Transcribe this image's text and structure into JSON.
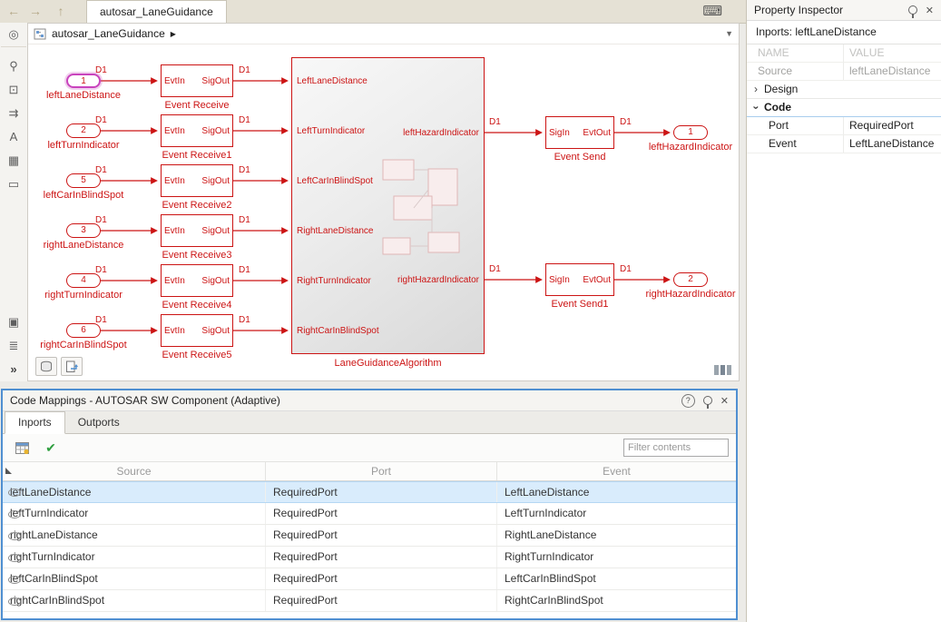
{
  "colors": {
    "diagram_red": "#cc1414",
    "selection_magenta": "#c943bd",
    "panel_border_blue": "#4f8fd1",
    "selected_row_blue": "#d9ecfc",
    "check_green": "#2e9e3e"
  },
  "topbar": {
    "tab_title": "autosar_LaneGuidance",
    "icons": {
      "back": "←",
      "forward": "→",
      "up": "↑",
      "keyboard": "⌨"
    }
  },
  "canvas": {
    "breadcrumb": "autosar_LaneGuidance",
    "crumb_arrow": "▶",
    "dropdown_caret": "▼"
  },
  "palette": {
    "icons": [
      {
        "name": "previous-view-icon",
        "glyph": "◎"
      },
      {
        "name": "zoom-icon",
        "glyph": "⚲"
      },
      {
        "name": "fit-to-view-icon",
        "glyph": "⊡"
      },
      {
        "name": "signal-routing-icon",
        "glyph": "⇉"
      },
      {
        "name": "annotation-icon",
        "glyph": "A"
      },
      {
        "name": "image-icon",
        "glyph": "▦"
      },
      {
        "name": "area-select-icon",
        "glyph": "▭"
      },
      {
        "name": "camera-icon",
        "glyph": "▣"
      },
      {
        "name": "model-layers-icon",
        "glyph": "≣"
      },
      {
        "name": "expand-toolstrip-icon",
        "glyph": "»"
      }
    ]
  },
  "diagram": {
    "signal_label": "D1",
    "receive_in": "EvtIn",
    "receive_out": "SigOut",
    "send_in": "SigIn",
    "send_out": "EvtOut",
    "inports": [
      {
        "num": "1",
        "label": "leftLaneDistance",
        "selected": true
      },
      {
        "num": "2",
        "label": "leftTurnIndicator",
        "selected": false
      },
      {
        "num": "5",
        "label": "leftCarInBlindSpot",
        "selected": false
      },
      {
        "num": "3",
        "label": "rightLaneDistance",
        "selected": false
      },
      {
        "num": "4",
        "label": "rightTurnIndicator",
        "selected": false
      },
      {
        "num": "6",
        "label": "rightCarInBlindSpot",
        "selected": false
      }
    ],
    "receive_blocks": [
      "Event Receive",
      "Event Receive1",
      "Event Receive2",
      "Event Receive3",
      "Event Receive4",
      "Event Receive5"
    ],
    "algorithm": {
      "label": "LaneGuidanceAlgorithm",
      "inputs": [
        "LeftLaneDistance",
        "LeftTurnIndicator",
        "LeftCarInBlindSpot",
        "RightLaneDistance",
        "RightTurnIndicator",
        "RightCarInBlindSpot"
      ],
      "outputs": [
        "leftHazardIndicator",
        "rightHazardIndicator"
      ]
    },
    "send_blocks": [
      "Event Send",
      "Event Send1"
    ],
    "outports": [
      {
        "num": "1",
        "label": "leftHazardIndicator"
      },
      {
        "num": "2",
        "label": "rightHazardIndicator"
      }
    ]
  },
  "code_mappings": {
    "title": "Code Mappings - AUTOSAR SW Component (Adaptive)",
    "tabs": [
      "Inports",
      "Outports"
    ],
    "active_tab": "Inports",
    "filter_placeholder": "Filter contents",
    "check_glyph": "✔",
    "help_glyph": "?",
    "close_glyph": "✕",
    "columns": [
      "Source",
      "Port",
      "Event"
    ],
    "rows": [
      {
        "source": "leftLaneDistance",
        "port": "RequiredPort",
        "event": "LeftLaneDistance",
        "selected": true
      },
      {
        "source": "leftTurnIndicator",
        "port": "RequiredPort",
        "event": "LeftTurnIndicator",
        "selected": false
      },
      {
        "source": "rightLaneDistance",
        "port": "RequiredPort",
        "event": "RightLaneDistance",
        "selected": false
      },
      {
        "source": "rightTurnIndicator",
        "port": "RequiredPort",
        "event": "RightTurnIndicator",
        "selected": false
      },
      {
        "source": "leftCarInBlindSpot",
        "port": "RequiredPort",
        "event": "LeftCarInBlindSpot",
        "selected": false
      },
      {
        "source": "rightCarInBlindSpot",
        "port": "RequiredPort",
        "event": "RightCarInBlindSpot",
        "selected": false
      }
    ]
  },
  "inspector": {
    "title": "Property Inspector",
    "context": "Inports: leftLaneDistance",
    "name_col": "NAME",
    "value_col": "VALUE",
    "close_glyph": "✕",
    "source_row": {
      "name": "Source",
      "value": "leftLaneDistance"
    },
    "design_section": "Design",
    "code_section": "Code",
    "code_rows": [
      {
        "name": "Port",
        "value": "RequiredPort"
      },
      {
        "name": "Event",
        "value": "LeftLaneDistance"
      }
    ]
  }
}
